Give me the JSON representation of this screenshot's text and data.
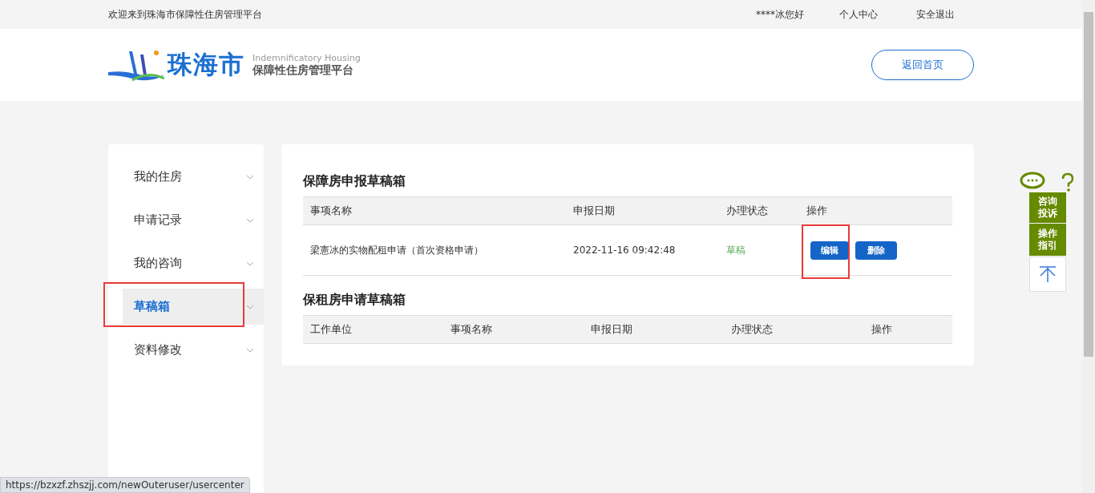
{
  "top_bar": {
    "welcome": "欢迎来到珠海市保障性住房管理平台",
    "user": "****冰您好",
    "links": [
      "个人中心",
      "安全退出"
    ]
  },
  "header": {
    "logo": {
      "city": "珠海市",
      "english": "Indemnificatory Housing",
      "platform": "保障性住房管理平台"
    },
    "home_button": "返回首页"
  },
  "sidebar": {
    "items": [
      {
        "label": "我的住房",
        "selected": false,
        "highlighted": false
      },
      {
        "label": "申请记录",
        "selected": false,
        "highlighted": false
      },
      {
        "label": "我的咨询",
        "selected": false,
        "highlighted": false
      },
      {
        "label": "草稿箱",
        "selected": true,
        "highlighted": true
      },
      {
        "label": "资料修改",
        "selected": false,
        "highlighted": false
      }
    ]
  },
  "sections": [
    {
      "title": "保障房申报草稿箱",
      "columns": [
        "事项名称",
        "申报日期",
        "办理状态",
        "操作"
      ],
      "rows": [
        {
          "cells": [
            "梁憲冰的实物配租申请（首次资格申请）",
            "2022-11-16 09:42:48",
            "草稿"
          ],
          "actions": [
            {
              "label": "编辑",
              "highlighted": true
            },
            {
              "label": "删除",
              "highlighted": false
            }
          ]
        }
      ]
    },
    {
      "title": "保租房申请草稿箱",
      "columns": [
        "工作单位",
        "事项名称",
        "申报日期",
        "办理状态",
        "操作"
      ]
    }
  ],
  "float_panel": {
    "items": [
      {
        "kind": "consult",
        "lines": [
          "咨询",
          "投诉"
        ]
      },
      {
        "kind": "guide",
        "lines": [
          "操作",
          "指引"
        ]
      },
      {
        "kind": "top"
      }
    ]
  },
  "status_url": "https://bzxzf.zhszjj.com/newOuteruser/usercenter"
}
